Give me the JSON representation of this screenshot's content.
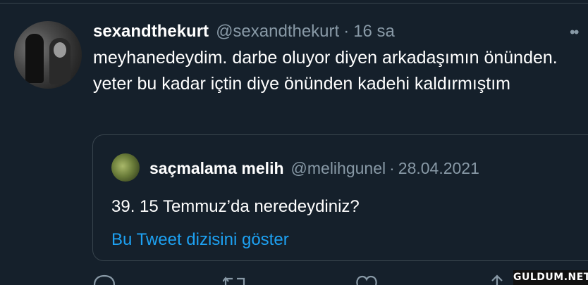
{
  "tweet": {
    "username": "sexandthekurt",
    "handle": "@sexandthekurt",
    "separator": "·",
    "time": "16 sa",
    "more_icon": "more-dots-icon",
    "text": "meyhanedeydim. darbe oluyor diyen arkadaşımın önünden. yeter bu kadar içtin diye önünden kadehi kaldırmıştım"
  },
  "quoted_tweet": {
    "name": "saçmalama melih",
    "handle": "@melihgunel",
    "separator": "·",
    "date": "28.04.2021",
    "text": "39. 15 Temmuz’da neredeydiniz?",
    "thread_link": "Bu Tweet dizisini göster"
  },
  "actions": {
    "icons": [
      "reply-icon",
      "retweet-icon",
      "like-icon",
      "share-icon"
    ]
  },
  "watermark": "GULDUM.NET",
  "colors": {
    "background": "#15202b",
    "text": "#ffffff",
    "muted": "#8899a6",
    "link": "#1da1f2",
    "border": "#38444d"
  }
}
